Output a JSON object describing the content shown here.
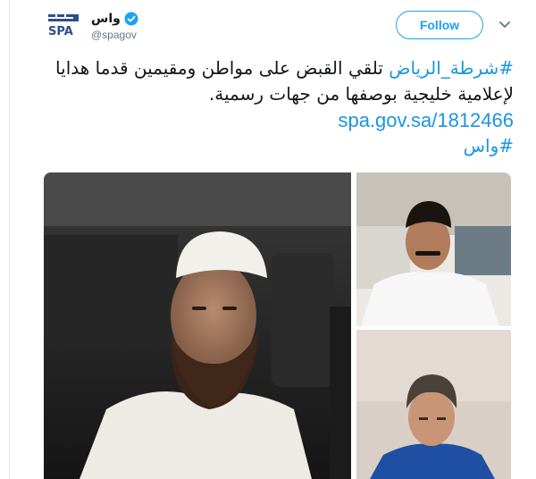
{
  "account": {
    "display_name": "واس",
    "handle": "@spagov",
    "verified": true,
    "logo_text_top": "واس",
    "logo_text_bottom": "SPA"
  },
  "actions": {
    "follow_label": "Follow",
    "more_icon": "chevron-down-icon"
  },
  "tweet": {
    "hashtag_1": "#شرطة_الرياض",
    "line_1_rest": " تلقي القبض على مواطن ومقيمين قدما هدايا",
    "line_2": "لإعلامية خليجية بوصفها من جهات رسمية.",
    "link": "spa.gov.sa/1812466",
    "hashtag_2": "#واس"
  },
  "media": {
    "photos": [
      "photo-1",
      "photo-2",
      "photo-3"
    ]
  },
  "colors": {
    "accent": "#1da1f2",
    "link": "#1b95e0",
    "logo": "#2f4e87"
  }
}
